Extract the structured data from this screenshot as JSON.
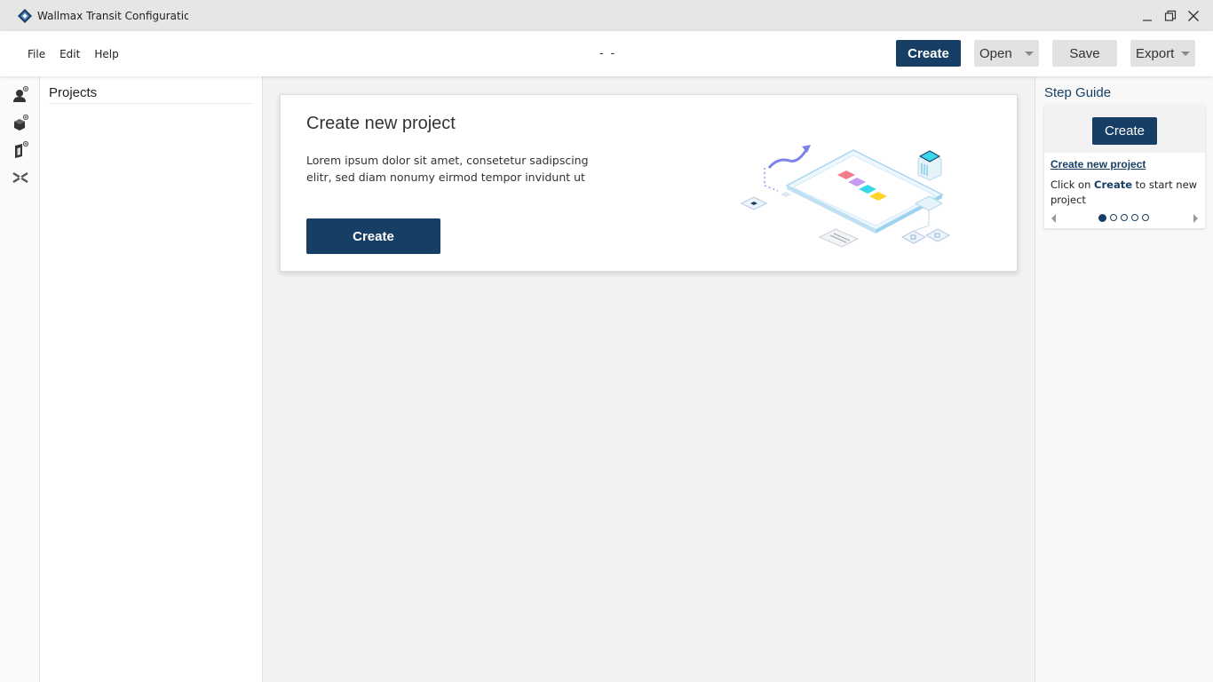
{
  "window": {
    "title": "Wallmax Transit Configuratior",
    "controls": [
      "minimize-icon",
      "restore-icon",
      "close-icon"
    ]
  },
  "menu": {
    "items": [
      {
        "label": "File"
      },
      {
        "label": "Edit"
      },
      {
        "label": "Help"
      }
    ]
  },
  "toolbar": {
    "doc_status": "- -",
    "create_label": "Create",
    "open_label": "Open",
    "save_label": "Save",
    "export_label": "Export"
  },
  "rail": {
    "icons": [
      "add-user-icon",
      "add-cube-icon",
      "add-device-icon",
      "tools-icon"
    ]
  },
  "projects": {
    "title": "Projects"
  },
  "main_card": {
    "title": "Create new project",
    "text": "Lorem ipsum dolor sit amet, consetetur sadipscing elitr, sed diam nonumy eirmod tempor invidunt ut",
    "button_label": "Create"
  },
  "step_guide": {
    "title": "Step Guide",
    "button_label": "Create",
    "link_text": "Create new project",
    "desc_prefix": "Click on ",
    "desc_bold": "Create",
    "desc_suffix": " to start new project",
    "total_steps": 5,
    "active_step": 1
  },
  "colors": {
    "accent": "#173f66",
    "button_gray": "#e2e2e2",
    "titlebar": "#e6e6e6"
  }
}
